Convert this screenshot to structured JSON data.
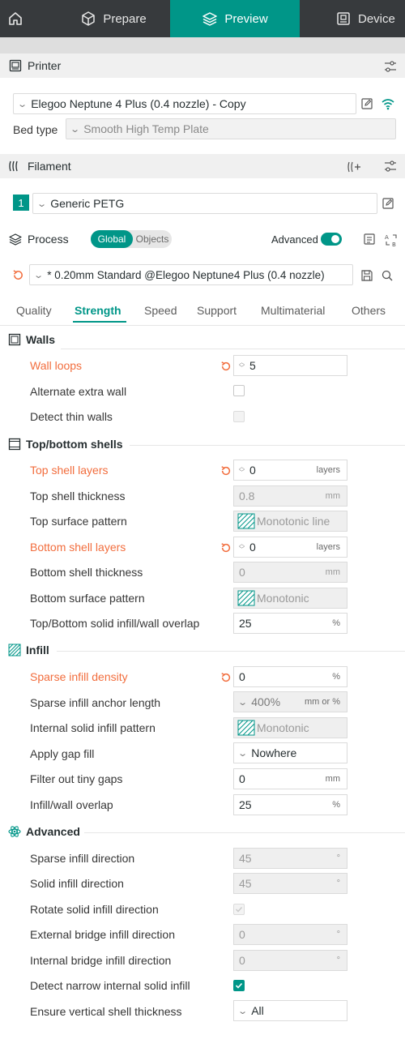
{
  "nav": {
    "home_icon": "home-icon",
    "prepare": "Prepare",
    "preview": "Preview",
    "device": "Device",
    "active_color": "#009688"
  },
  "printer": {
    "title": "Printer",
    "preset": "Elegoo Neptune 4 Plus (0.4 nozzle) - Copy",
    "bed_type_label": "Bed type",
    "bed_type": "Smooth High Temp Plate"
  },
  "filament": {
    "title": "Filament",
    "slot": "1",
    "preset": "Generic PETG",
    "slot_color": "#009688"
  },
  "process": {
    "title": "Process",
    "toggle_global": "Global",
    "toggle_objects": "Objects",
    "advanced_label": "Advanced",
    "preset": "* 0.20mm Standard @Elegoo Neptune4 Plus (0.4 nozzle)"
  },
  "tabs": [
    "Quality",
    "Strength",
    "Speed",
    "Support",
    "Multimaterial",
    "Others"
  ],
  "walls": {
    "title": "Walls",
    "wall_loops": {
      "label": "Wall loops",
      "value": "5"
    },
    "alternate_extra_wall": {
      "label": "Alternate extra wall"
    },
    "detect_thin_walls": {
      "label": "Detect thin walls"
    }
  },
  "shells": {
    "title": "Top/bottom shells",
    "top_layers": {
      "label": "Top shell layers",
      "value": "0",
      "unit": "layers"
    },
    "top_thickness": {
      "label": "Top shell thickness",
      "value": "0.8",
      "unit": "mm"
    },
    "top_pattern": {
      "label": "Top surface pattern",
      "value": "Monotonic line"
    },
    "bottom_layers": {
      "label": "Bottom shell layers",
      "value": "0",
      "unit": "layers"
    },
    "bottom_thickness": {
      "label": "Bottom shell thickness",
      "value": "0",
      "unit": "mm"
    },
    "bottom_pattern": {
      "label": "Bottom surface pattern",
      "value": "Monotonic"
    },
    "overlap": {
      "label": "Top/Bottom solid infill/wall overlap",
      "value": "25",
      "unit": "%"
    }
  },
  "infill": {
    "title": "Infill",
    "density": {
      "label": "Sparse infill density",
      "value": "0",
      "unit": "%"
    },
    "anchor": {
      "label": "Sparse infill anchor length",
      "value": "400%",
      "unit": "mm or %"
    },
    "solid_pattern": {
      "label": "Internal solid infill pattern",
      "value": "Monotonic"
    },
    "gap_fill": {
      "label": "Apply gap fill",
      "value": "Nowhere"
    },
    "filter_gaps": {
      "label": "Filter out tiny gaps",
      "value": "0",
      "unit": "mm"
    },
    "wall_overlap": {
      "label": "Infill/wall overlap",
      "value": "25",
      "unit": "%"
    }
  },
  "advanced": {
    "title": "Advanced",
    "sparse_dir": {
      "label": "Sparse infill direction",
      "value": "45",
      "unit": "°"
    },
    "solid_dir": {
      "label": "Solid infill direction",
      "value": "45",
      "unit": "°"
    },
    "rotate_solid": {
      "label": "Rotate solid infill direction"
    },
    "ext_bridge": {
      "label": "External bridge infill direction",
      "value": "0",
      "unit": "°"
    },
    "int_bridge": {
      "label": "Internal bridge infill direction",
      "value": "0",
      "unit": "°"
    },
    "narrow_solid": {
      "label": "Detect narrow internal solid infill"
    },
    "vertical_shell": {
      "label": "Ensure vertical shell thickness",
      "value": "All"
    }
  },
  "colors": {
    "modified_label": "#f26d3d",
    "accent": "#009688"
  }
}
